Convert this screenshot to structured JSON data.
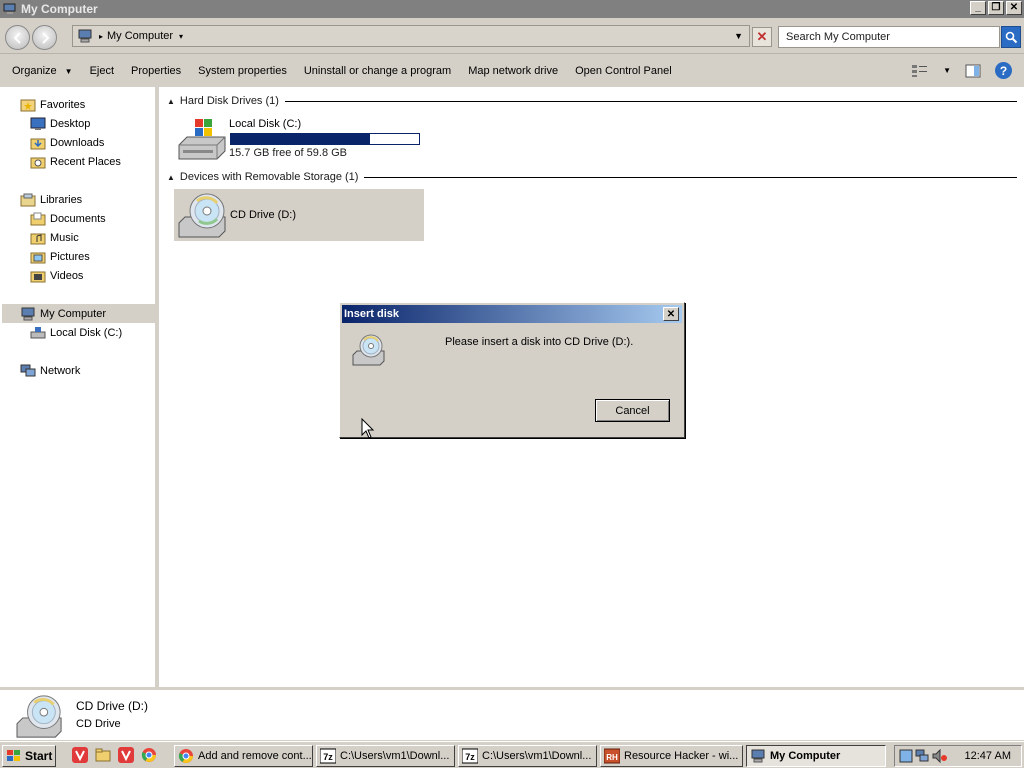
{
  "window": {
    "title": "My Computer",
    "min": "_",
    "max": "❐",
    "close": "✕"
  },
  "address": {
    "crumb": "My Computer",
    "search_placeholder": "Search My Computer"
  },
  "toolbar": {
    "organize": "Organize",
    "eject": "Eject",
    "properties": "Properties",
    "system_properties": "System properties",
    "uninstall": "Uninstall or change a program",
    "map_drive": "Map network drive",
    "control_panel": "Open Control Panel",
    "help": "?"
  },
  "sidebar": {
    "favorites": "Favorites",
    "desktop": "Desktop",
    "downloads": "Downloads",
    "recent": "Recent Places",
    "libraries": "Libraries",
    "documents": "Documents",
    "music": "Music",
    "pictures": "Pictures",
    "videos": "Videos",
    "my_computer": "My Computer",
    "local_disk": "Local Disk (C:)",
    "network": "Network"
  },
  "main": {
    "hdd_group": "Hard Disk Drives (1)",
    "local_disk": {
      "name": "Local Disk (C:)",
      "free": "15.7 GB free of 59.8 GB",
      "used_fraction": 0.74
    },
    "removable_group": "Devices with Removable Storage (1)",
    "cd_drive": "CD Drive (D:)"
  },
  "dialog": {
    "title": "Insert disk",
    "message": "Please insert a disk into CD Drive (D:).",
    "cancel": "Cancel",
    "close": "✕"
  },
  "details": {
    "name": "CD Drive (D:)",
    "type": "CD Drive"
  },
  "taskbar": {
    "start": "Start",
    "tasks": [
      "Add and remove cont...",
      "C:\\Users\\vm1\\Downl...",
      "C:\\Users\\vm1\\Downl...",
      "Resource Hacker - wi...",
      "My Computer"
    ],
    "clock": "12:47 AM"
  },
  "colors": {
    "progress": "#0a246a",
    "dialog_title": "#0a246a",
    "titlebar": "#808080"
  }
}
